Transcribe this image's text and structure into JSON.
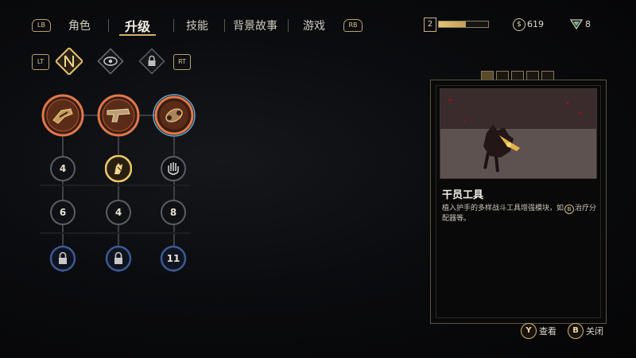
{
  "nav": {
    "lb": "LB",
    "rb": "RB",
    "tabs": [
      {
        "label": "角色"
      },
      {
        "label": "升级"
      },
      {
        "label": "技能"
      },
      {
        "label": "背景故事"
      },
      {
        "label": "游戏"
      }
    ]
  },
  "status": {
    "level": "2",
    "xp_fraction": 0.55,
    "coins": "619",
    "coin_icon": "$",
    "tokens": "8"
  },
  "trees": {
    "lt": "LT",
    "rt": "RT",
    "tabs": [
      "gadget-tree-icon",
      "eye-tree-icon",
      "lock-icon"
    ]
  },
  "upgrades": {
    "perks": [
      "gauntlet-icon",
      "pistol-icon",
      "drone-icon"
    ],
    "rows": [
      [
        {
          "value": "4"
        },
        {
          "value": "",
          "icon": "hand-energy-icon"
        },
        {
          "value": "",
          "icon": "palm-icon"
        }
      ],
      [
        {
          "value": "6"
        },
        {
          "value": "4"
        },
        {
          "value": "8"
        }
      ],
      [
        {
          "value": "",
          "icon": "lock-icon"
        },
        {
          "value": "",
          "icon": "lock-icon"
        },
        {
          "value": "11"
        }
      ]
    ]
  },
  "detail": {
    "title": "干员工具",
    "desc_1": "植入护手的多样战斗工具增强模块，如",
    "desc_btn": "B",
    "desc_2": "治疗分配器等。"
  },
  "prompts": {
    "view_btn": "Y",
    "view_label": "查看",
    "close_btn": "B",
    "close_label": "关闭"
  },
  "colors": {
    "gold": "#d4b16c",
    "node_ring": "#4a4d55",
    "locked_ring": "#3c5a96"
  }
}
